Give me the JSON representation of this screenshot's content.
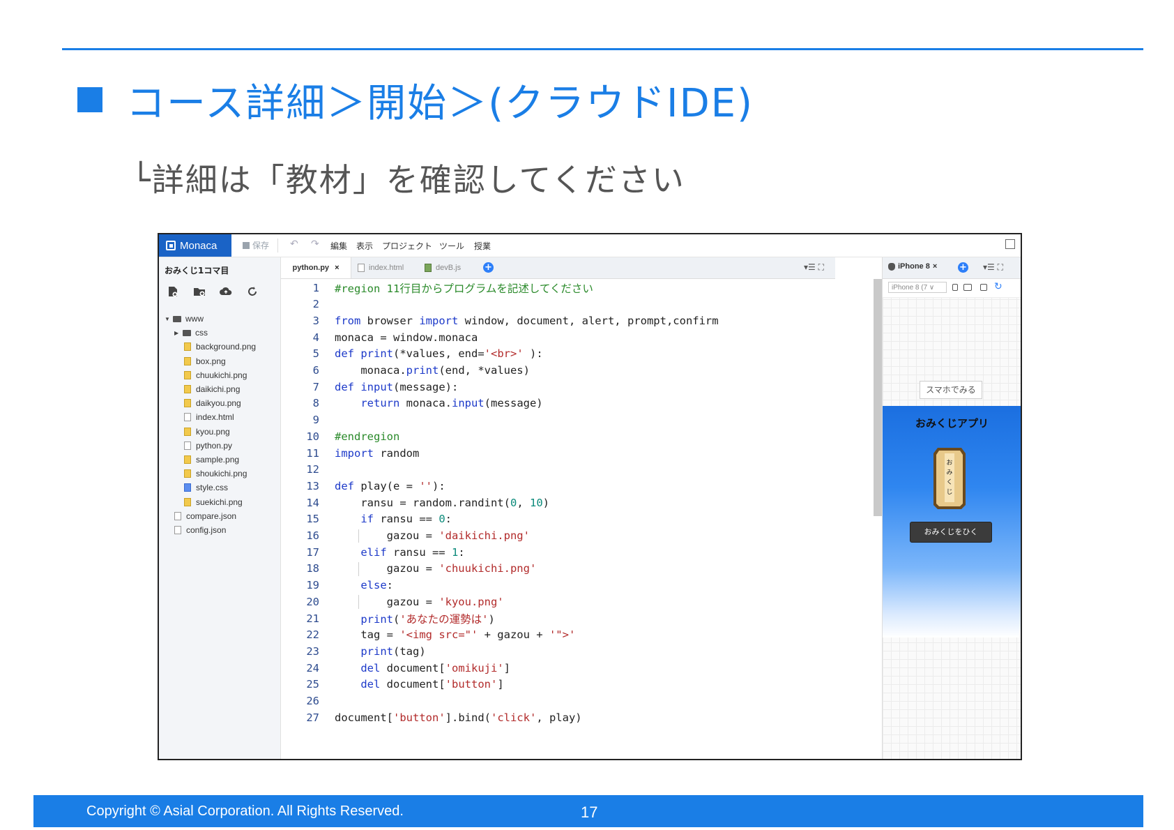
{
  "slide": {
    "title": "コース詳細＞開始＞(クラウドIDE)",
    "subtitle": "└詳細は「教材」を確認してください"
  },
  "ide": {
    "brand": "Monaca",
    "save_label": "保存",
    "menu": [
      "編集",
      "表示",
      "プロジェクト",
      "ツール",
      "授業"
    ],
    "project_title": "おみくじ1コマ目",
    "tabs": [
      {
        "label": "python.py",
        "active": true
      },
      {
        "label": "index.html",
        "active": false
      },
      {
        "label": "devB.js",
        "active": false
      }
    ],
    "file_tree": [
      {
        "label": "www",
        "type": "folder",
        "depth": 0,
        "expanded": true
      },
      {
        "label": "css",
        "type": "folder",
        "depth": 1,
        "expanded": false
      },
      {
        "label": "background.png",
        "type": "img",
        "depth": 2
      },
      {
        "label": "box.png",
        "type": "img",
        "depth": 2
      },
      {
        "label": "chuukichi.png",
        "type": "img",
        "depth": 2
      },
      {
        "label": "daikichi.png",
        "type": "img",
        "depth": 2
      },
      {
        "label": "daikyou.png",
        "type": "img",
        "depth": 2
      },
      {
        "label": "index.html",
        "type": "html",
        "depth": 2
      },
      {
        "label": "kyou.png",
        "type": "img",
        "depth": 2
      },
      {
        "label": "python.py",
        "type": "py",
        "depth": 2
      },
      {
        "label": "sample.png",
        "type": "img",
        "depth": 2
      },
      {
        "label": "shoukichi.png",
        "type": "img",
        "depth": 2
      },
      {
        "label": "style.css",
        "type": "css",
        "depth": 2
      },
      {
        "label": "suekichi.png",
        "type": "img",
        "depth": 2
      },
      {
        "label": "compare.json",
        "type": "json",
        "depth": 1
      },
      {
        "label": "config.json",
        "type": "json",
        "depth": 1
      }
    ],
    "code": [
      {
        "n": "1",
        "t": "#region 11行目からプログラムを記述してください"
      },
      {
        "n": "2",
        "t": ""
      },
      {
        "n": "3",
        "t": "from browser import window, document, alert, prompt,confirm"
      },
      {
        "n": "4",
        "t": "monaca = window.monaca"
      },
      {
        "n": "5",
        "t": "def print(*values, end='<br>' ):"
      },
      {
        "n": "6",
        "t": "    monaca.print(end, *values)"
      },
      {
        "n": "7",
        "t": "def input(message):"
      },
      {
        "n": "8",
        "t": "    return monaca.input(message)"
      },
      {
        "n": "9",
        "t": ""
      },
      {
        "n": "10",
        "t": "#endregion"
      },
      {
        "n": "11",
        "t": "import random"
      },
      {
        "n": "12",
        "t": ""
      },
      {
        "n": "13",
        "t": "def play(e = ''):"
      },
      {
        "n": "14",
        "t": "    ransu = random.randint(0, 10)"
      },
      {
        "n": "15",
        "t": "    if ransu == 0:"
      },
      {
        "n": "16",
        "t": "        gazou = 'daikichi.png'"
      },
      {
        "n": "17",
        "t": "    elif ransu == 1:"
      },
      {
        "n": "18",
        "t": "        gazou = 'chuukichi.png'"
      },
      {
        "n": "19",
        "t": "    else:"
      },
      {
        "n": "20",
        "t": "        gazou = 'kyou.png'"
      },
      {
        "n": "21",
        "t": "    print('あなたの運勢は')"
      },
      {
        "n": "22",
        "t": "    tag = '<img src=\"' + gazou + '\">'"
      },
      {
        "n": "23",
        "t": "    print(tag)"
      },
      {
        "n": "24",
        "t": "    del document['omikuji']"
      },
      {
        "n": "25",
        "t": "    del document['button']"
      },
      {
        "n": "26",
        "t": ""
      },
      {
        "n": "27",
        "t": "document['button'].bind('click', play)"
      }
    ],
    "preview": {
      "tab_label": "iPhone 8",
      "device_select": "iPhone 8 (7 ∨",
      "smartphone_button": "スマホでみる",
      "app_title": "おみくじアプリ",
      "box_text": "おみくじ",
      "draw_button": "おみくじをひく"
    }
  },
  "footer": {
    "copyright": "Copyright ©  Asial Corporation. All Rights Reserved.",
    "page": "17"
  },
  "colors": {
    "accent": "#1a7ee6",
    "brand": "#1a63c6"
  }
}
